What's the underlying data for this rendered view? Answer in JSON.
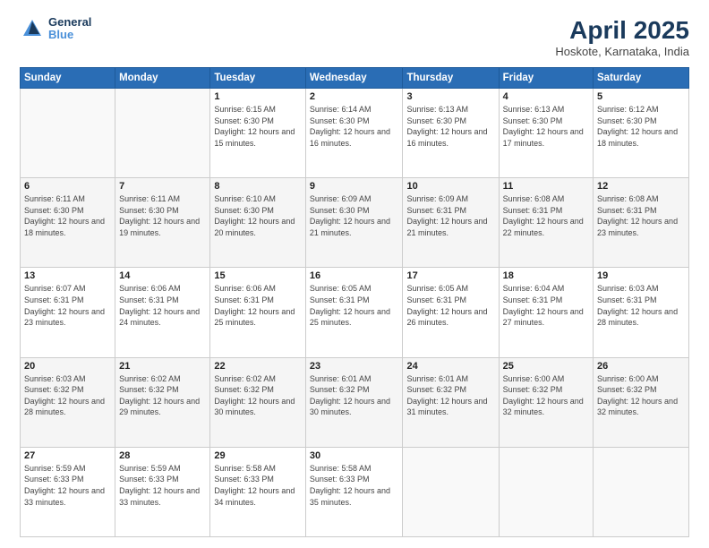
{
  "header": {
    "logo_line1": "General",
    "logo_line2": "Blue",
    "month_year": "April 2025",
    "location": "Hoskote, Karnataka, India"
  },
  "weekdays": [
    "Sunday",
    "Monday",
    "Tuesday",
    "Wednesday",
    "Thursday",
    "Friday",
    "Saturday"
  ],
  "weeks": [
    [
      {
        "day": "",
        "sunrise": "",
        "sunset": "",
        "daylight": ""
      },
      {
        "day": "",
        "sunrise": "",
        "sunset": "",
        "daylight": ""
      },
      {
        "day": "1",
        "sunrise": "Sunrise: 6:15 AM",
        "sunset": "Sunset: 6:30 PM",
        "daylight": "Daylight: 12 hours and 15 minutes."
      },
      {
        "day": "2",
        "sunrise": "Sunrise: 6:14 AM",
        "sunset": "Sunset: 6:30 PM",
        "daylight": "Daylight: 12 hours and 16 minutes."
      },
      {
        "day": "3",
        "sunrise": "Sunrise: 6:13 AM",
        "sunset": "Sunset: 6:30 PM",
        "daylight": "Daylight: 12 hours and 16 minutes."
      },
      {
        "day": "4",
        "sunrise": "Sunrise: 6:13 AM",
        "sunset": "Sunset: 6:30 PM",
        "daylight": "Daylight: 12 hours and 17 minutes."
      },
      {
        "day": "5",
        "sunrise": "Sunrise: 6:12 AM",
        "sunset": "Sunset: 6:30 PM",
        "daylight": "Daylight: 12 hours and 18 minutes."
      }
    ],
    [
      {
        "day": "6",
        "sunrise": "Sunrise: 6:11 AM",
        "sunset": "Sunset: 6:30 PM",
        "daylight": "Daylight: 12 hours and 18 minutes."
      },
      {
        "day": "7",
        "sunrise": "Sunrise: 6:11 AM",
        "sunset": "Sunset: 6:30 PM",
        "daylight": "Daylight: 12 hours and 19 minutes."
      },
      {
        "day": "8",
        "sunrise": "Sunrise: 6:10 AM",
        "sunset": "Sunset: 6:30 PM",
        "daylight": "Daylight: 12 hours and 20 minutes."
      },
      {
        "day": "9",
        "sunrise": "Sunrise: 6:09 AM",
        "sunset": "Sunset: 6:30 PM",
        "daylight": "Daylight: 12 hours and 21 minutes."
      },
      {
        "day": "10",
        "sunrise": "Sunrise: 6:09 AM",
        "sunset": "Sunset: 6:31 PM",
        "daylight": "Daylight: 12 hours and 21 minutes."
      },
      {
        "day": "11",
        "sunrise": "Sunrise: 6:08 AM",
        "sunset": "Sunset: 6:31 PM",
        "daylight": "Daylight: 12 hours and 22 minutes."
      },
      {
        "day": "12",
        "sunrise": "Sunrise: 6:08 AM",
        "sunset": "Sunset: 6:31 PM",
        "daylight": "Daylight: 12 hours and 23 minutes."
      }
    ],
    [
      {
        "day": "13",
        "sunrise": "Sunrise: 6:07 AM",
        "sunset": "Sunset: 6:31 PM",
        "daylight": "Daylight: 12 hours and 23 minutes."
      },
      {
        "day": "14",
        "sunrise": "Sunrise: 6:06 AM",
        "sunset": "Sunset: 6:31 PM",
        "daylight": "Daylight: 12 hours and 24 minutes."
      },
      {
        "day": "15",
        "sunrise": "Sunrise: 6:06 AM",
        "sunset": "Sunset: 6:31 PM",
        "daylight": "Daylight: 12 hours and 25 minutes."
      },
      {
        "day": "16",
        "sunrise": "Sunrise: 6:05 AM",
        "sunset": "Sunset: 6:31 PM",
        "daylight": "Daylight: 12 hours and 25 minutes."
      },
      {
        "day": "17",
        "sunrise": "Sunrise: 6:05 AM",
        "sunset": "Sunset: 6:31 PM",
        "daylight": "Daylight: 12 hours and 26 minutes."
      },
      {
        "day": "18",
        "sunrise": "Sunrise: 6:04 AM",
        "sunset": "Sunset: 6:31 PM",
        "daylight": "Daylight: 12 hours and 27 minutes."
      },
      {
        "day": "19",
        "sunrise": "Sunrise: 6:03 AM",
        "sunset": "Sunset: 6:31 PM",
        "daylight": "Daylight: 12 hours and 28 minutes."
      }
    ],
    [
      {
        "day": "20",
        "sunrise": "Sunrise: 6:03 AM",
        "sunset": "Sunset: 6:32 PM",
        "daylight": "Daylight: 12 hours and 28 minutes."
      },
      {
        "day": "21",
        "sunrise": "Sunrise: 6:02 AM",
        "sunset": "Sunset: 6:32 PM",
        "daylight": "Daylight: 12 hours and 29 minutes."
      },
      {
        "day": "22",
        "sunrise": "Sunrise: 6:02 AM",
        "sunset": "Sunset: 6:32 PM",
        "daylight": "Daylight: 12 hours and 30 minutes."
      },
      {
        "day": "23",
        "sunrise": "Sunrise: 6:01 AM",
        "sunset": "Sunset: 6:32 PM",
        "daylight": "Daylight: 12 hours and 30 minutes."
      },
      {
        "day": "24",
        "sunrise": "Sunrise: 6:01 AM",
        "sunset": "Sunset: 6:32 PM",
        "daylight": "Daylight: 12 hours and 31 minutes."
      },
      {
        "day": "25",
        "sunrise": "Sunrise: 6:00 AM",
        "sunset": "Sunset: 6:32 PM",
        "daylight": "Daylight: 12 hours and 32 minutes."
      },
      {
        "day": "26",
        "sunrise": "Sunrise: 6:00 AM",
        "sunset": "Sunset: 6:32 PM",
        "daylight": "Daylight: 12 hours and 32 minutes."
      }
    ],
    [
      {
        "day": "27",
        "sunrise": "Sunrise: 5:59 AM",
        "sunset": "Sunset: 6:33 PM",
        "daylight": "Daylight: 12 hours and 33 minutes."
      },
      {
        "day": "28",
        "sunrise": "Sunrise: 5:59 AM",
        "sunset": "Sunset: 6:33 PM",
        "daylight": "Daylight: 12 hours and 33 minutes."
      },
      {
        "day": "29",
        "sunrise": "Sunrise: 5:58 AM",
        "sunset": "Sunset: 6:33 PM",
        "daylight": "Daylight: 12 hours and 34 minutes."
      },
      {
        "day": "30",
        "sunrise": "Sunrise: 5:58 AM",
        "sunset": "Sunset: 6:33 PM",
        "daylight": "Daylight: 12 hours and 35 minutes."
      },
      {
        "day": "",
        "sunrise": "",
        "sunset": "",
        "daylight": ""
      },
      {
        "day": "",
        "sunrise": "",
        "sunset": "",
        "daylight": ""
      },
      {
        "day": "",
        "sunrise": "",
        "sunset": "",
        "daylight": ""
      }
    ]
  ]
}
